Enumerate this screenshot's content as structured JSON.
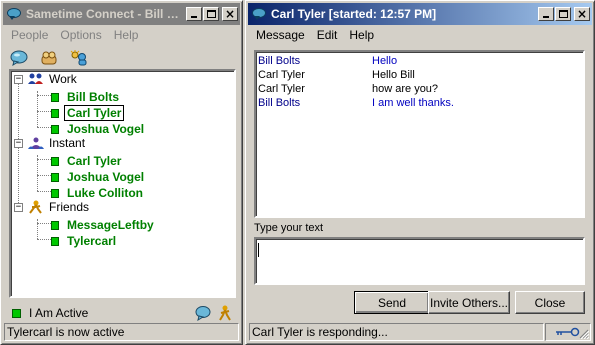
{
  "left_window": {
    "title": "Sametime Connect - Bill Bo...",
    "menu": [
      "People",
      "Options",
      "Help"
    ],
    "toolbar_icons": [
      "chat-icon",
      "people-search-icon",
      "add-contact-icon"
    ],
    "tree": [
      {
        "group": "Work",
        "icon": "group-people-icon",
        "contacts": [
          {
            "name": "Bill Bolts",
            "selected": false
          },
          {
            "name": "Carl Tyler",
            "selected": true
          },
          {
            "name": "Joshua Vogel",
            "selected": false
          }
        ]
      },
      {
        "group": "Instant",
        "icon": "group-instant-icon",
        "contacts": [
          {
            "name": "Carl Tyler",
            "selected": false
          },
          {
            "name": "Joshua Vogel",
            "selected": false
          },
          {
            "name": "Luke Colliton",
            "selected": false
          }
        ]
      },
      {
        "group": "Friends",
        "icon": "group-friends-icon",
        "contacts": [
          {
            "name": "MessageLeftby",
            "selected": false
          },
          {
            "name": "Tylercarl",
            "selected": false
          }
        ]
      }
    ],
    "status": "I Am Active",
    "statusbar": "Tylercarl is now active"
  },
  "chat_window": {
    "title": "Carl Tyler [started: 12:57 PM]",
    "menu": [
      "Message",
      "Edit",
      "Help"
    ],
    "messages": [
      {
        "sender": "Bill Bolts",
        "text": "Hello",
        "self": true
      },
      {
        "sender": "Carl Tyler",
        "text": "Hello Bill",
        "self": false
      },
      {
        "sender": "Carl Tyler",
        "text": "how are you?",
        "self": false
      },
      {
        "sender": "Bill Bolts",
        "text": "I am well thanks.",
        "self": true
      }
    ],
    "input_label": "Type your text",
    "input_value": "",
    "buttons": {
      "send": "Send",
      "invite": "Invite Others...",
      "close": "Close"
    },
    "statusbar": "Carl Tyler is responding...",
    "status_icon": "encryption-key-icon"
  },
  "colors": {
    "title_active": "#0a246a",
    "title_inactive": "#808080",
    "contact_green": "#008000",
    "self_blue": "#0000c0"
  }
}
